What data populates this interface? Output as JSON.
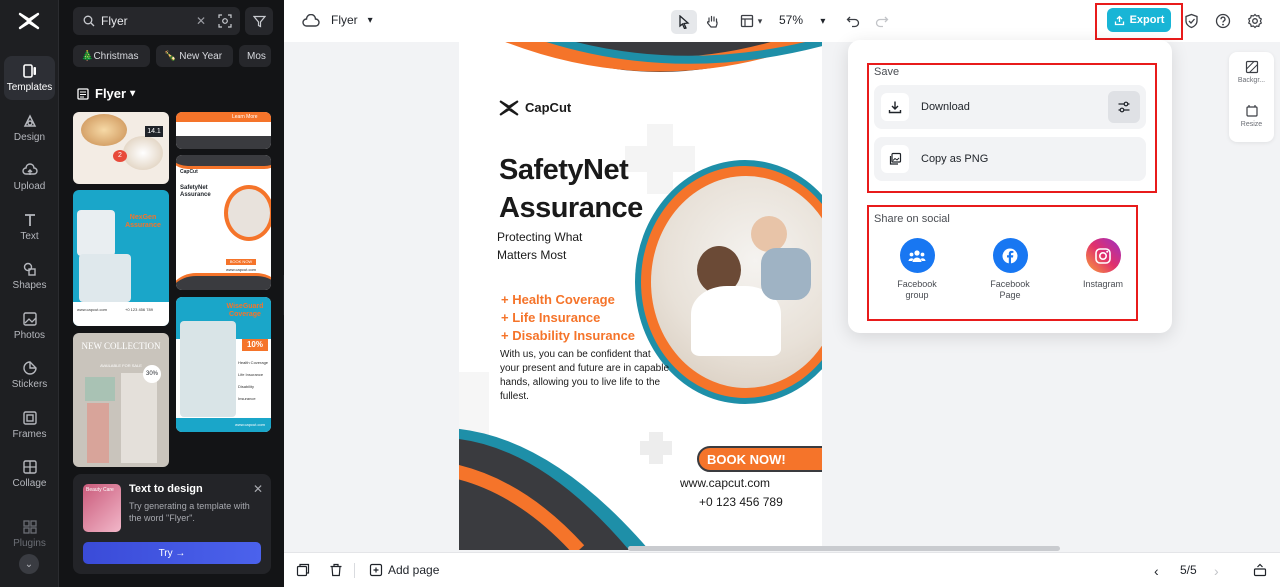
{
  "rail": {
    "items": [
      {
        "label": "Templates",
        "active": true
      },
      {
        "label": "Design"
      },
      {
        "label": "Upload"
      },
      {
        "label": "Text"
      },
      {
        "label": "Shapes"
      },
      {
        "label": "Photos"
      },
      {
        "label": "Stickers"
      },
      {
        "label": "Frames"
      },
      {
        "label": "Collage"
      },
      {
        "label": "Plugins"
      }
    ]
  },
  "panel": {
    "search_value": "Flyer",
    "chips": [
      "🎄Christmas",
      "🍾 New Year",
      "Mos"
    ],
    "category": "Flyer",
    "text_to_design": {
      "title": "Text to design",
      "description": "Try generating a template with the word \"Flyer\".",
      "try_label": "Try →",
      "image_caption": "Beauty Care"
    },
    "thumbs": {
      "food": {
        "badge": "14.1",
        "badge2": "2"
      },
      "nexgen": {
        "title": "NexGen Assurance",
        "site": "www.capcut.com",
        "phone": "+0 123 456 789"
      },
      "safety_small": {
        "brand": "CapCut",
        "title": "SafetyNet Assurance",
        "cta": "BOOK NOW",
        "site": "www.capcut.com"
      },
      "collection": {
        "title": "NEW COLLECTION",
        "sub": "AVAILABLE FOR SALE",
        "badge": "30%"
      },
      "wiseguard": {
        "title": "WiseGuard Coverage",
        "badge": "10%",
        "items": [
          "Health Coverage",
          "Life Insurance",
          "Disability Insurance"
        ],
        "site": "www.capcut.com"
      },
      "top_right_cta": "Learn More"
    }
  },
  "topbar": {
    "doc_name": "Flyer",
    "zoom": "57%",
    "export_label": "Export"
  },
  "flyer": {
    "brand": "CapCut",
    "title_line1": "SafetyNet",
    "title_line2": "Assurance",
    "subtitle_line1": "Protecting What",
    "subtitle_line2": "Matters Most",
    "bullets": [
      "+ Health Coverage",
      "+ Life Insurance",
      "+ Disability Insurance"
    ],
    "body": "With us, you can be confident that your present and future are in capable hands, allowing you to live life to the fullest.",
    "cta": "BOOK NOW!",
    "website": "www.capcut.com",
    "phone": "+0 123 456 789"
  },
  "mini_toolbar": {
    "background_label": "Backgr...",
    "resize_label": "Resize"
  },
  "export_popover": {
    "save_label": "Save",
    "download_label": "Download",
    "copy_png_label": "Copy as PNG",
    "share_label": "Share on social",
    "social": [
      {
        "label_line1": "Facebook",
        "label_line2": "group"
      },
      {
        "label_line1": "Facebook",
        "label_line2": "Page"
      },
      {
        "label_line1": "Instagram",
        "label_line2": ""
      }
    ]
  },
  "bottombar": {
    "add_page_label": "Add page",
    "page_indicator": "5/5"
  },
  "colors": {
    "accent": "#18b5d6",
    "highlight": "#e81b1b",
    "flyer_orange": "#f5742a",
    "flyer_teal": "#1e8fa8",
    "flyer_dark": "#3a3b3f"
  }
}
